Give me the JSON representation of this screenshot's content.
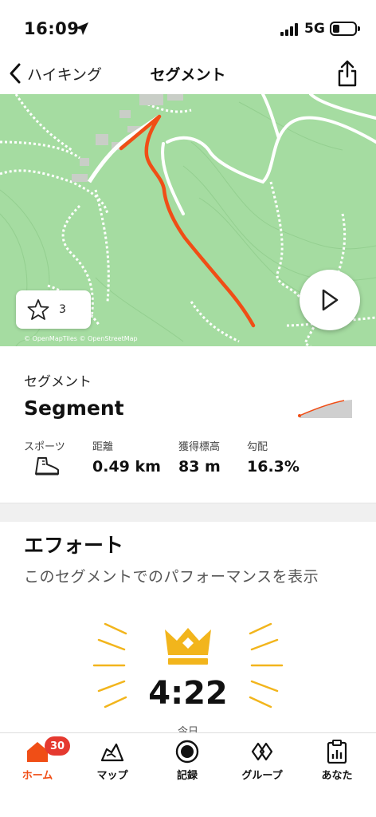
{
  "status_bar": {
    "time": "16:09",
    "network": "5G"
  },
  "nav": {
    "back_label": "ハイキング",
    "title": "セグメント"
  },
  "map": {
    "favorite_count": "3",
    "attribution": "© OpenMapTiles © OpenStreetMap",
    "route_color": "#f04e16"
  },
  "segment": {
    "label": "セグメント",
    "name": "Segment",
    "stats": [
      {
        "label": "スポーツ",
        "value": ""
      },
      {
        "label": "距離",
        "value": "0.49 km"
      },
      {
        "label": "獲得標高",
        "value": "83 m"
      },
      {
        "label": "勾配",
        "value": "16.3%"
      }
    ],
    "sport_icon": "hiking-boot-icon"
  },
  "effort": {
    "title": "エフォート",
    "subtitle": "このセグメントでのパフォーマンスを表示",
    "time": "4:22",
    "date": "今日",
    "crown_color": "#f2b51c"
  },
  "tabbar": {
    "items": [
      {
        "label": "ホーム",
        "icon": "home-icon",
        "active": true
      },
      {
        "label": "マップ",
        "icon": "map-icon"
      },
      {
        "label": "記録",
        "icon": "record-icon"
      },
      {
        "label": "グループ",
        "icon": "groups-icon"
      },
      {
        "label": "あなた",
        "icon": "profile-icon"
      }
    ],
    "home_badge": "30",
    "accent": "#f04e16"
  }
}
